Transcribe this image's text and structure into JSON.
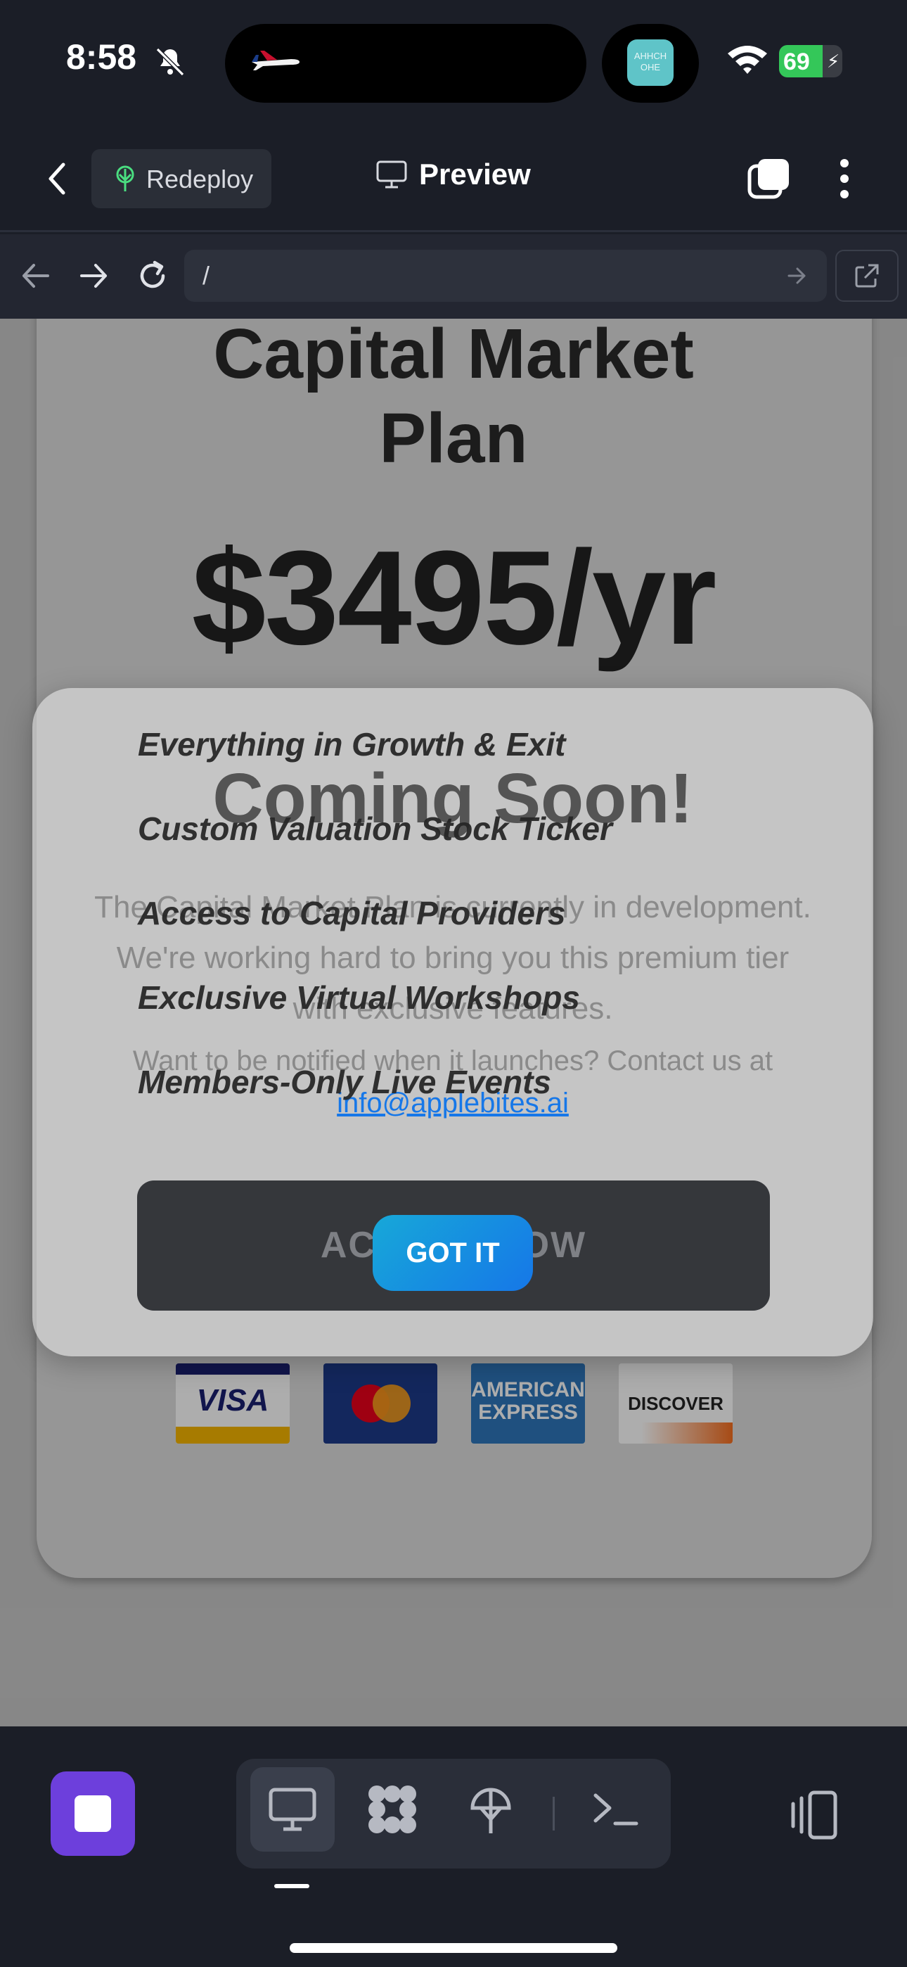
{
  "status_bar": {
    "time": "8:58",
    "battery": "69",
    "battery_level": 0.69,
    "notification_app_icon_text": "АННСН ОНЕ"
  },
  "header": {
    "redeploy_label": "Redeploy",
    "title": "Preview"
  },
  "browser": {
    "url": "/"
  },
  "page": {
    "plan_title_line1": "Capital Market",
    "plan_title_line2": "Plan",
    "price": "$3495/yr",
    "features": [
      "Everything in Growth & Exit",
      "Custom Valuation Stock Ticker",
      "Access to Capital Providers",
      "Exclusive Virtual Workshops",
      "Members-Only Live Events"
    ],
    "access_button": "ACCESS NOW",
    "payment_cards": {
      "visa": "VISA",
      "amex_line1": "AMERICAN",
      "amex_line2": "EXPRESS",
      "discover": "DISCOVER"
    }
  },
  "modal": {
    "title": "Coming Soon!",
    "body": "The Capital Market Plan is currently in development. We're working hard to bring you this premium tier with exclusive features.",
    "contact_prefix": "Want to be notified when it launches? Contact us at",
    "email": "info@applebites.ai",
    "button": "GOT IT"
  },
  "colors": {
    "accent": "#6d3fdc",
    "button_gradient_start": "#17a8d8",
    "button_gradient_end": "#1677e8",
    "background": "#1b1e27"
  },
  "icons": [
    "bell-slash-icon",
    "plane-icon",
    "wifi-icon",
    "chevron-left-icon",
    "tree-icon",
    "monitor-icon",
    "tabs-icon",
    "more-vertical-icon",
    "arrow-left-icon",
    "arrow-right-icon",
    "reload-icon",
    "external-link-icon",
    "stop-icon",
    "grid-icon",
    "terminal-icon",
    "device-switch-icon"
  ]
}
